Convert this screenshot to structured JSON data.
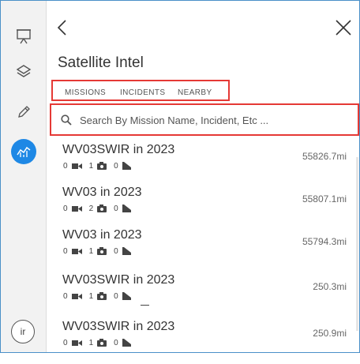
{
  "panel": {
    "title": "Satellite Intel",
    "tabs": [
      {
        "label": "MISSIONS"
      },
      {
        "label": "INCIDENTS"
      },
      {
        "label": "NEARBY"
      }
    ],
    "search": {
      "placeholder": "Search By Mission Name, Incident, Etc ..."
    }
  },
  "sidebar": {
    "items": [
      {
        "icon": "presentation-board-icon"
      },
      {
        "icon": "layers-icon"
      },
      {
        "icon": "pencil-icon"
      },
      {
        "icon": "analytics-icon",
        "active": true
      }
    ],
    "avatar": "ir"
  },
  "missions": [
    {
      "name": "WV03SWIR in 2023",
      "distance": "55826.7mi",
      "videos": "0",
      "images": "1",
      "incidents": "0"
    },
    {
      "name": "WV03 in 2023",
      "distance": "55807.1mi",
      "videos": "0",
      "images": "2",
      "incidents": "0"
    },
    {
      "name": "WV03 in 2023",
      "distance": "55794.3mi",
      "videos": "0",
      "images": "1",
      "incidents": "0"
    },
    {
      "name": "WV03SWIR in 2023",
      "distance": "250.3mi",
      "videos": "0",
      "images": "1",
      "incidents": "0"
    },
    {
      "name": "WV03SWIR in 2023",
      "distance": "250.9mi",
      "videos": "0",
      "images": "1",
      "incidents": "0"
    }
  ],
  "colors": {
    "accent": "#1e88e5",
    "highlight": "#e53935"
  }
}
